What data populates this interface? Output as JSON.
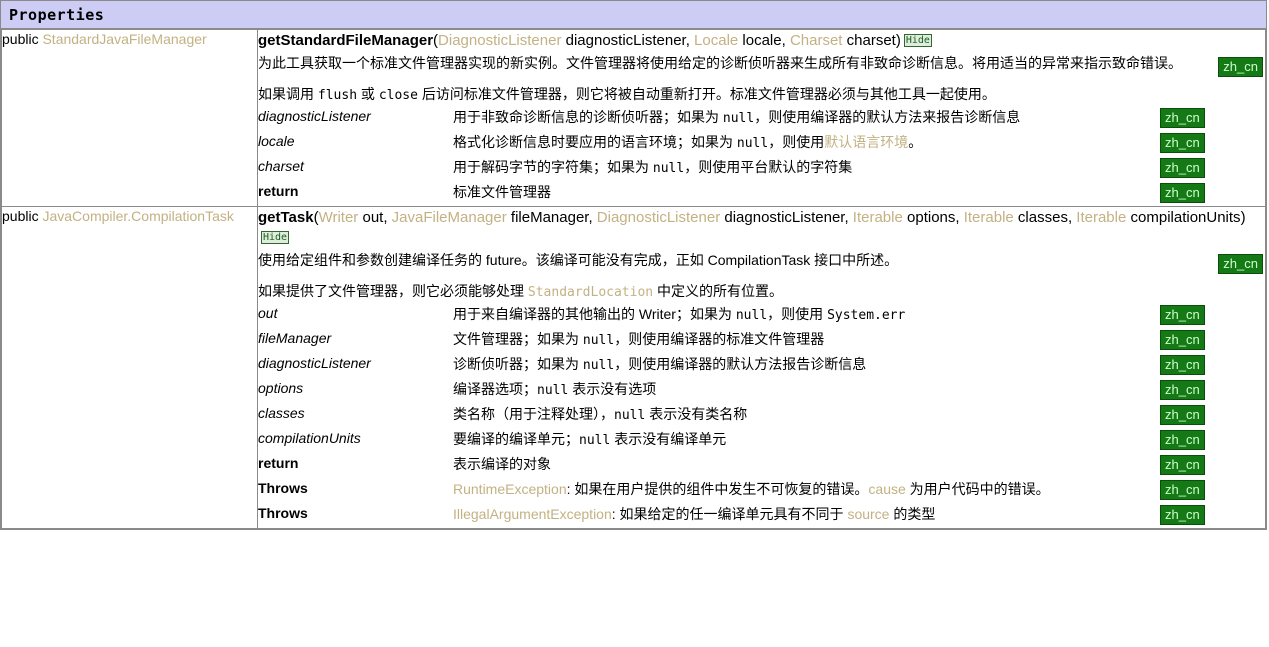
{
  "panel": {
    "title": "Properties"
  },
  "badges": {
    "hide_label": "Hide",
    "zh_label": "zh_cn"
  },
  "colors": {
    "header_bg": "#ccccf5",
    "link": "#c3b183",
    "zh_badge_bg": "#157a15",
    "zh_badge_text": "#ccffcc",
    "hide_badge_bg": "#ddeedd",
    "hide_badge_text": "#1f5c1f",
    "border": "#8a8a8a"
  },
  "rows": [
    {
      "signature": {
        "modifier": "public",
        "type": "StandardJavaFileManager"
      },
      "method": {
        "name": "getStandardFileManager",
        "open_paren": "(",
        "parts": [
          {
            "kind": "link",
            "text": "DiagnosticListener"
          },
          {
            "kind": "plain",
            "text": " diagnosticListener, "
          },
          {
            "kind": "link",
            "text": "Locale"
          },
          {
            "kind": "plain",
            "text": " locale, "
          },
          {
            "kind": "link",
            "text": "Charset"
          },
          {
            "kind": "plain",
            "text": " charset"
          }
        ],
        "close_paren": ")"
      },
      "descriptions": [
        {
          "parts": [
            {
              "kind": "plain",
              "text": "为此工具获取一个标准文件管理器实现的新实例。文件管理器将使用给定的诊断侦听器来生成所有非致命诊断信息。将用适当的异常来指示致命错误。"
            }
          ],
          "badge": true
        },
        {
          "parts": [
            {
              "kind": "plain",
              "text": "如果调用 "
            },
            {
              "kind": "mono",
              "text": "flush"
            },
            {
              "kind": "plain",
              "text": " 或 "
            },
            {
              "kind": "mono",
              "text": "close"
            },
            {
              "kind": "plain",
              "text": " 后访问标准文件管理器，则它将被自动重新打开。标准文件管理器必须与其他工具一起使用。"
            }
          ],
          "badge": false
        }
      ],
      "params": [
        {
          "name": "diagnosticListener",
          "bold": false,
          "parts": [
            {
              "kind": "plain",
              "text": "用于非致命诊断信息的诊断侦听器；如果为 "
            },
            {
              "kind": "mono",
              "text": "null"
            },
            {
              "kind": "plain",
              "text": "，则使用编译器的默认方法来报告诊断信息"
            }
          ]
        },
        {
          "name": "locale",
          "bold": false,
          "parts": [
            {
              "kind": "plain",
              "text": "格式化诊断信息时要应用的语言环境；如果为 "
            },
            {
              "kind": "mono",
              "text": "null"
            },
            {
              "kind": "plain",
              "text": "，则使用"
            },
            {
              "kind": "link",
              "text": "默认语言环境"
            },
            {
              "kind": "plain",
              "text": "。"
            }
          ]
        },
        {
          "name": "charset",
          "bold": false,
          "parts": [
            {
              "kind": "plain",
              "text": "用于解码字节的字符集；如果为 "
            },
            {
              "kind": "mono",
              "text": "null"
            },
            {
              "kind": "plain",
              "text": "，则使用平台默认的字符集"
            }
          ]
        },
        {
          "name": "return",
          "bold": true,
          "parts": [
            {
              "kind": "plain",
              "text": "标准文件管理器"
            }
          ]
        }
      ]
    },
    {
      "signature": {
        "modifier": "public",
        "type": "JavaCompiler.CompilationTask"
      },
      "method": {
        "name": "getTask",
        "open_paren": "(",
        "parts": [
          {
            "kind": "link",
            "text": "Writer"
          },
          {
            "kind": "plain",
            "text": " out, "
          },
          {
            "kind": "link",
            "text": "JavaFileManager"
          },
          {
            "kind": "plain",
            "text": " fileManager, "
          },
          {
            "kind": "link",
            "text": "DiagnosticListener"
          },
          {
            "kind": "plain",
            "text": " diagnosticListener, "
          },
          {
            "kind": "link",
            "text": "Iterable"
          },
          {
            "kind": "plain",
            "text": " options, "
          },
          {
            "kind": "link",
            "text": "Iterable"
          },
          {
            "kind": "plain",
            "text": " classes, "
          },
          {
            "kind": "link",
            "text": "Iterable"
          },
          {
            "kind": "plain",
            "text": " compilationUnits"
          }
        ],
        "close_paren": ")"
      },
      "descriptions": [
        {
          "parts": [
            {
              "kind": "plain",
              "text": "使用给定组件和参数创建编译任务的 future。该编译可能没有完成，正如 CompilationTask 接口中所述。"
            }
          ],
          "badge": true
        },
        {
          "parts": [
            {
              "kind": "plain",
              "text": "如果提供了文件管理器，则它必须能够处理 "
            },
            {
              "kind": "mono-link",
              "text": "StandardLocation"
            },
            {
              "kind": "plain",
              "text": " 中定义的所有位置。"
            }
          ],
          "badge": false
        }
      ],
      "params": [
        {
          "name": "out",
          "bold": false,
          "parts": [
            {
              "kind": "plain",
              "text": "用于来自编译器的其他输出的 Writer；如果为 "
            },
            {
              "kind": "mono",
              "text": "null"
            },
            {
              "kind": "plain",
              "text": "，则使用 "
            },
            {
              "kind": "mono",
              "text": "System.err"
            }
          ]
        },
        {
          "name": "fileManager",
          "bold": false,
          "parts": [
            {
              "kind": "plain",
              "text": "文件管理器；如果为 "
            },
            {
              "kind": "mono",
              "text": "null"
            },
            {
              "kind": "plain",
              "text": "，则使用编译器的标准文件管理器"
            }
          ]
        },
        {
          "name": "diagnosticListener",
          "bold": false,
          "parts": [
            {
              "kind": "plain",
              "text": "诊断侦听器；如果为 "
            },
            {
              "kind": "mono",
              "text": "null"
            },
            {
              "kind": "plain",
              "text": "，则使用编译器的默认方法报告诊断信息"
            }
          ]
        },
        {
          "name": "options",
          "bold": false,
          "parts": [
            {
              "kind": "plain",
              "text": "编译器选项；"
            },
            {
              "kind": "mono",
              "text": "null"
            },
            {
              "kind": "plain",
              "text": " 表示没有选项"
            }
          ]
        },
        {
          "name": "classes",
          "bold": false,
          "parts": [
            {
              "kind": "plain",
              "text": "类名称（用于注释处理），"
            },
            {
              "kind": "mono",
              "text": "null"
            },
            {
              "kind": "plain",
              "text": " 表示没有类名称"
            }
          ]
        },
        {
          "name": "compilationUnits",
          "bold": false,
          "parts": [
            {
              "kind": "plain",
              "text": "要编译的编译单元；"
            },
            {
              "kind": "mono",
              "text": "null"
            },
            {
              "kind": "plain",
              "text": " 表示没有编译单元"
            }
          ]
        },
        {
          "name": "return",
          "bold": true,
          "parts": [
            {
              "kind": "plain",
              "text": "表示编译的对象"
            }
          ]
        },
        {
          "name": "Throws",
          "bold": true,
          "parts": [
            {
              "kind": "link",
              "text": "RuntimeException"
            },
            {
              "kind": "plain",
              "text": ": 如果在用户提供的组件中发生不可恢复的错误。"
            },
            {
              "kind": "link",
              "text": "cause"
            },
            {
              "kind": "plain",
              "text": " 为用户代码中的错误。"
            }
          ]
        },
        {
          "name": "Throws",
          "bold": true,
          "parts": [
            {
              "kind": "link",
              "text": "IllegalArgumentException"
            },
            {
              "kind": "plain",
              "text": ": 如果给定的任一编译单元具有不同于 "
            },
            {
              "kind": "link",
              "text": "source"
            },
            {
              "kind": "plain",
              "text": " 的类型"
            }
          ]
        }
      ]
    }
  ]
}
